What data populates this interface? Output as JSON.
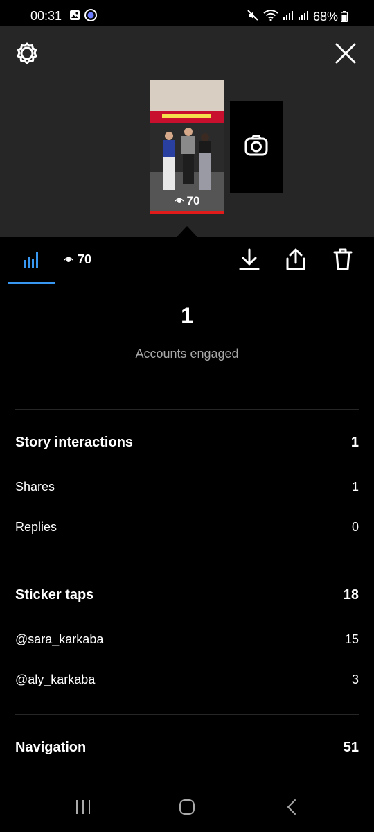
{
  "status_bar": {
    "time": "00:31",
    "battery": "68%",
    "icons": [
      "gallery-icon",
      "app-badge-icon",
      "mute-icon",
      "wifi-icon",
      "signal-icon",
      "signal-icon",
      "battery-icon"
    ]
  },
  "header": {
    "settings_icon": "settings-gear-icon",
    "close_icon": "close-icon"
  },
  "story": {
    "thumbnail_views": "70",
    "camera_icon": "camera-icon"
  },
  "toolbar": {
    "insights_icon": "bar-chart-icon",
    "views_count": "70",
    "download_icon": "download-icon",
    "share_icon": "share-icon",
    "delete_icon": "trash-icon",
    "accent_color": "#3897f0"
  },
  "overview": {
    "accounts_engaged_value": "1",
    "accounts_engaged_label": "Accounts engaged"
  },
  "sections": {
    "story_interactions": {
      "label": "Story interactions",
      "value": "1",
      "rows": [
        {
          "label": "Shares",
          "value": "1"
        },
        {
          "label": "Replies",
          "value": "0"
        }
      ]
    },
    "sticker_taps": {
      "label": "Sticker taps",
      "value": "18",
      "rows": [
        {
          "label": "@sara_karkaba",
          "value": "15"
        },
        {
          "label": "@aly_karkaba",
          "value": "3"
        }
      ]
    },
    "navigation": {
      "label": "Navigation",
      "value": "51"
    }
  },
  "nav_bar": {
    "icons": [
      "recent-apps-icon",
      "home-icon",
      "back-icon"
    ]
  }
}
